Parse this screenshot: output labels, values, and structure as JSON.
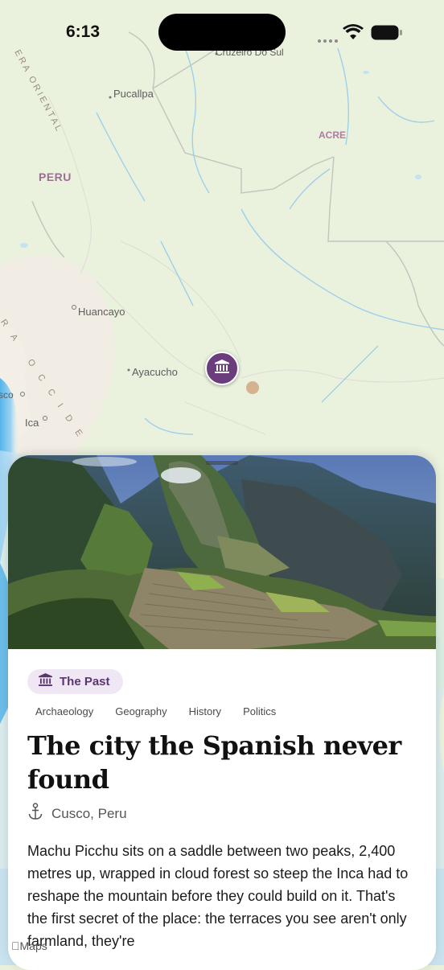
{
  "status_bar": {
    "time": "6:13"
  },
  "map": {
    "labels": {
      "cruzeiro": "Cruzeiro Do Sul",
      "pucallpa": "Pucallpa",
      "acre": "ACRE",
      "peru": "PERU",
      "huancayo": "Huancayo",
      "ayacucho": "Ayacucho",
      "ica": "Ica",
      "sco": "sco",
      "oriental": "ERA ORIENTAL",
      "occidental": "RA OCCIDE"
    },
    "pin_icon": "museum-icon",
    "legal": "Maps"
  },
  "card": {
    "category": {
      "icon": "museum-icon",
      "label": "The Past"
    },
    "tags": [
      "Archaeology",
      "Geography",
      "History",
      "Politics"
    ],
    "title": "The city the Spanish never found",
    "location": {
      "icon": "anchor-icon",
      "text": "Cusco, Peru"
    },
    "body": "Machu Picchu sits on a saddle between two peaks, 2,400 metres up, wrapped in cloud forest so steep the Inca had to reshape the mountain before they could build on it. That's the first secret of the place: the terraces you see aren't only farmland, they're"
  },
  "colors": {
    "accent": "#6b3d7c",
    "badge_bg": "#efe8f4",
    "map_bg": "#e9f0dc",
    "water": "#8ec9ee"
  }
}
